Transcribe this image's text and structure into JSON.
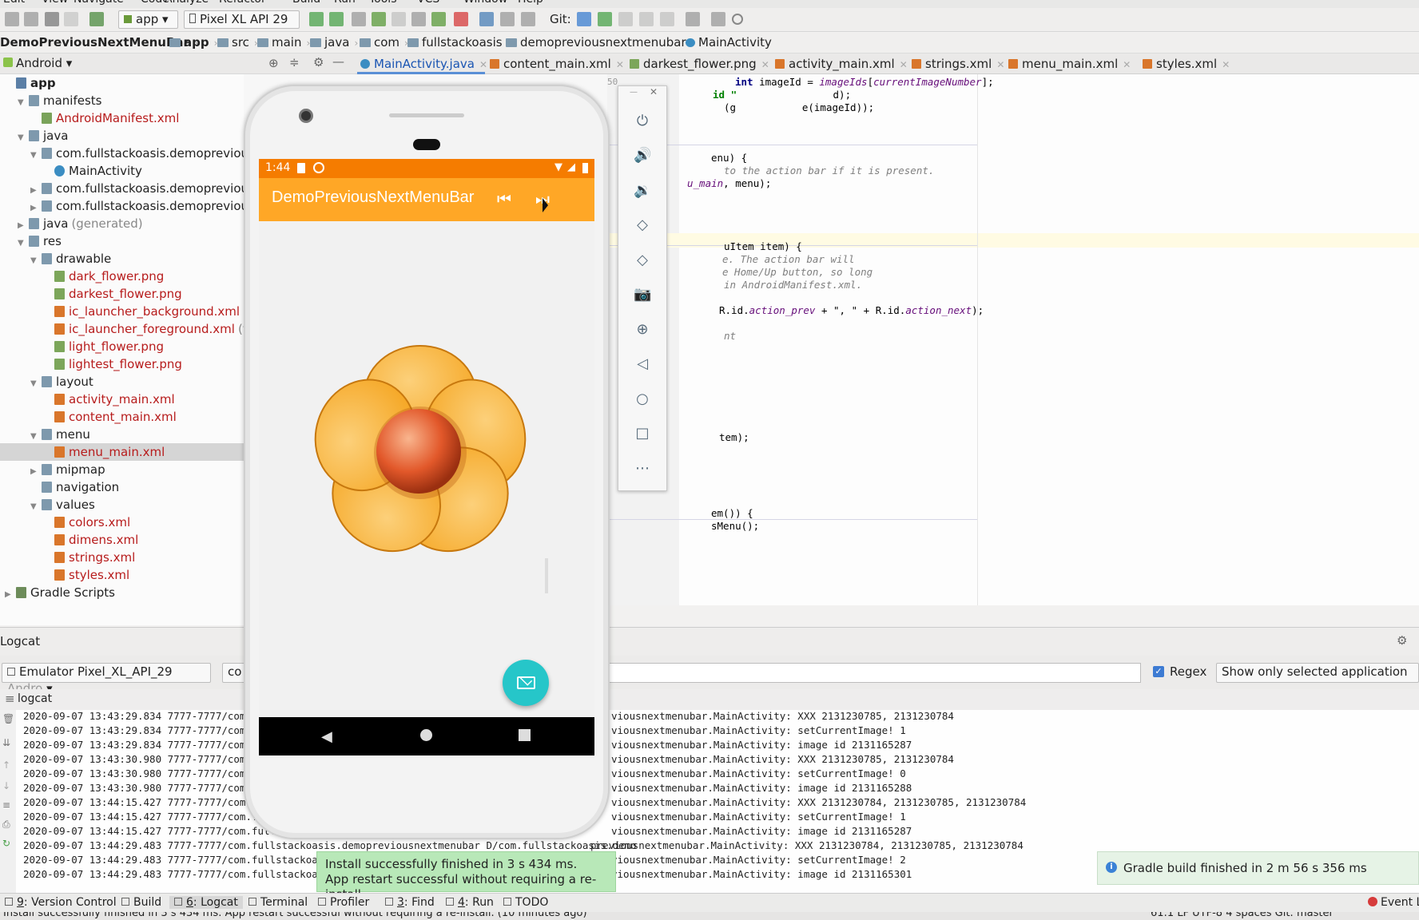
{
  "menubar": [
    "Edit",
    "View",
    "Navigate",
    "Code",
    "Analyze",
    "Refactor",
    "Build",
    "Run",
    "Tools",
    "VCS",
    "Window",
    "Help"
  ],
  "toolbar": {
    "run_config": "app",
    "device": "Pixel XL API 29",
    "git_label": "Git:"
  },
  "breadcrumb": [
    "DemoPreviousNextMenuBar",
    "app",
    "src",
    "main",
    "java",
    "com",
    "fullstackoasis",
    "demopreviousnextmenubar",
    "MainActivity"
  ],
  "project_view": {
    "mode": "Android"
  },
  "editor_tabs": [
    "MainActivity.java",
    "content_main.xml",
    "darkest_flower.png",
    "activity_main.xml",
    "strings.xml",
    "menu_main.xml",
    "styles.xml"
  ],
  "tree": [
    {
      "label": "app",
      "depth": 0,
      "kind": "module",
      "bold": true
    },
    {
      "label": "manifests",
      "depth": 1,
      "kind": "folder",
      "open": true
    },
    {
      "label": "AndroidManifest.xml",
      "depth": 2,
      "kind": "manifest"
    },
    {
      "label": "java",
      "depth": 1,
      "kind": "folder",
      "open": true
    },
    {
      "label": "com.fullstackoasis.demopreviousr",
      "depth": 2,
      "kind": "package",
      "open": true
    },
    {
      "label": "MainActivity",
      "depth": 3,
      "kind": "class"
    },
    {
      "label": "com.fullstackoasis.demopreviousr",
      "depth": 2,
      "kind": "package",
      "open": false
    },
    {
      "label": "com.fullstackoasis.demopreviousr",
      "depth": 2,
      "kind": "package",
      "open": false
    },
    {
      "label": "java",
      "depth": 1,
      "kind": "folder",
      "open": false,
      "suffix": "(generated)"
    },
    {
      "label": "res",
      "depth": 1,
      "kind": "folder",
      "open": true
    },
    {
      "label": "drawable",
      "depth": 2,
      "kind": "folder",
      "open": true
    },
    {
      "label": "dark_flower.png",
      "depth": 3,
      "kind": "png"
    },
    {
      "label": "darkest_flower.png",
      "depth": 3,
      "kind": "png"
    },
    {
      "label": "ic_launcher_background.xml",
      "depth": 3,
      "kind": "xml"
    },
    {
      "label": "ic_launcher_foreground.xml",
      "depth": 3,
      "kind": "xml",
      "suffix": "(v2"
    },
    {
      "label": "light_flower.png",
      "depth": 3,
      "kind": "png"
    },
    {
      "label": "lightest_flower.png",
      "depth": 3,
      "kind": "png"
    },
    {
      "label": "layout",
      "depth": 2,
      "kind": "folder",
      "open": true
    },
    {
      "label": "activity_main.xml",
      "depth": 3,
      "kind": "xml"
    },
    {
      "label": "content_main.xml",
      "depth": 3,
      "kind": "xml"
    },
    {
      "label": "menu",
      "depth": 2,
      "kind": "folder",
      "open": true
    },
    {
      "label": "menu_main.xml",
      "depth": 3,
      "kind": "xml",
      "selected": true
    },
    {
      "label": "mipmap",
      "depth": 2,
      "kind": "folder",
      "open": false
    },
    {
      "label": "navigation",
      "depth": 2,
      "kind": "folder",
      "open": null
    },
    {
      "label": "values",
      "depth": 2,
      "kind": "folder",
      "open": true
    },
    {
      "label": "colors.xml",
      "depth": 3,
      "kind": "xml"
    },
    {
      "label": "dimens.xml",
      "depth": 3,
      "kind": "xml"
    },
    {
      "label": "strings.xml",
      "depth": 3,
      "kind": "xml"
    },
    {
      "label": "styles.xml",
      "depth": 3,
      "kind": "xml"
    },
    {
      "label": "Gradle Scripts",
      "depth": 0,
      "kind": "gradle",
      "open": false
    }
  ],
  "code": {
    "line_number": "50",
    "lines": [
      {
        "segments": [
          {
            "t": "int ",
            "c": "kw"
          },
          {
            "t": "imageId = "
          },
          {
            "t": "imageIds",
            "c": "fld"
          },
          {
            "t": "["
          },
          {
            "t": "currentImageNumber",
            "c": "fld"
          },
          {
            "t": "];"
          }
        ]
      },
      {
        "segments": [
          {
            "t": "id \"",
            "c": "str"
          },
          {
            "t": "                d);"
          }
        ]
      },
      {
        "segments": [
          {
            "t": "(g"
          },
          {
            "t": "           e(imageId));"
          }
        ]
      },
      {
        "segments": [
          {
            "t": "enu) {"
          }
        ]
      },
      {
        "segments": [
          {
            "t": "to the action bar if it is present.",
            "c": "cm"
          }
        ]
      },
      {
        "segments": [
          {
            "t": "u_main",
            "c": "fld"
          },
          {
            "t": ", menu);"
          }
        ]
      },
      {
        "segments": [
          {
            "t": "uItem item) {"
          }
        ]
      },
      {
        "segments": [
          {
            "t": "e. The action bar will",
            "c": "cm"
          }
        ]
      },
      {
        "segments": [
          {
            "t": "e Home/Up button, so long",
            "c": "cm"
          }
        ]
      },
      {
        "segments": [
          {
            "t": "in AndroidManifest.xml.",
            "c": "cm"
          }
        ]
      },
      {
        "segments": [
          {
            "t": "R.id."
          },
          {
            "t": "action_prev",
            "c": "fld"
          },
          {
            "t": " + \", \" + R.id."
          },
          {
            "t": "action_next",
            "c": "fld"
          },
          {
            "t": ");"
          }
        ]
      },
      {
        "segments": [
          {
            "t": "nt",
            "c": "cm"
          }
        ]
      },
      {
        "segments": [
          {
            "t": "tem);"
          }
        ]
      },
      {
        "segments": [
          {
            "t": "em()) {"
          }
        ]
      },
      {
        "segments": [
          {
            "t": "sMenu();"
          }
        ]
      }
    ]
  },
  "phone": {
    "status_time": "1:44",
    "app_title": "DemoPreviousNextMenuBar",
    "colors": {
      "status": "#f57c00",
      "toolbar": "#ffa726",
      "fab": "#26c6c9",
      "navbar": "#000000",
      "flower": "#f5a623",
      "center": "#e2582a"
    }
  },
  "logcat": {
    "title": "Logcat",
    "device": "Emulator Pixel_XL_API_29",
    "device_suffix": "Andro",
    "filter_prefix": "co",
    "regex_label": "Regex",
    "filter_mode": "Show only selected application",
    "sub_label": "logcat",
    "lines_left": [
      "2020-09-07 13:43:29.834 7777-7777/com.f",
      "2020-09-07 13:43:29.834 7777-7777/com.f",
      "2020-09-07 13:43:29.834 7777-7777/com.f",
      "2020-09-07 13:43:30.980 7777-7777/com.f",
      "2020-09-07 13:43:30.980 7777-7777/com.f",
      "2020-09-07 13:43:30.980 7777-7777/com.f",
      "2020-09-07 13:44:15.427 7777-7777/com.fu",
      "2020-09-07 13:44:15.427 7777-7777/com.fu",
      "2020-09-07 13:44:15.427 7777-7777/com.fulls",
      "2020-09-07 13:44:29.483 7777-7777/com.fullstackoasis.demopreviousnextmenubar D/com.fullstackoasis.demo",
      "2020-09-07 13:44:29.483 7777-7777/com.fullstackoasis",
      "2020-09-07 13:44:29.483 7777-7777/com.fullstackoasis"
    ],
    "lines_right": [
      "viousnextmenubar.MainActivity: XXX 2131230785, 2131230784",
      "viousnextmenubar.MainActivity: setCurrentImage! 1",
      "viousnextmenubar.MainActivity: image id 2131165287",
      "viousnextmenubar.MainActivity: XXX 2131230785, 2131230784",
      "viousnextmenubar.MainActivity: setCurrentImage! 0",
      "viousnextmenubar.MainActivity: image id 2131165288",
      "viousnextmenubar.MainActivity: XXX 2131230784, 2131230785, 2131230784",
      "viousnextmenubar.MainActivity: setCurrentImage! 1",
      "viousnextmenubar.MainActivity: image id 2131165287",
      "previousnextmenubar.MainActivity: XXX 2131230784, 2131230785, 2131230784",
      "viousnextmenubar.MainActivity: setCurrentImage! 2",
      "viousnextmenubar.MainActivity: image id 2131165301"
    ]
  },
  "toast": {
    "line1": "Install successfully finished in 3 s 434 ms.",
    "line2": "App restart successful without requiring a re-install."
  },
  "gradle_popup": "Gradle build finished in 2 m 56 s 356 ms",
  "bottom_tabs": [
    {
      "num": "9",
      "label": ": Version Control"
    },
    {
      "num": "",
      "label": "Build"
    },
    {
      "num": "6",
      "label": ": Logcat",
      "active": true
    },
    {
      "num": "",
      "label": "Terminal"
    },
    {
      "num": "",
      "label": "Profiler"
    },
    {
      "num": "3",
      "label": ": Find"
    },
    {
      "num": "4",
      "label": ": Run"
    },
    {
      "num": "",
      "label": "TODO"
    }
  ],
  "event_log": "Event Lo",
  "statusbar": {
    "message": "Install successfully finished in 3 s 434 ms: App restart successful without requiring a re-install. (10 minutes ago)",
    "position": "61:1  LF  UTF-8  4 spaces  Git: master"
  }
}
